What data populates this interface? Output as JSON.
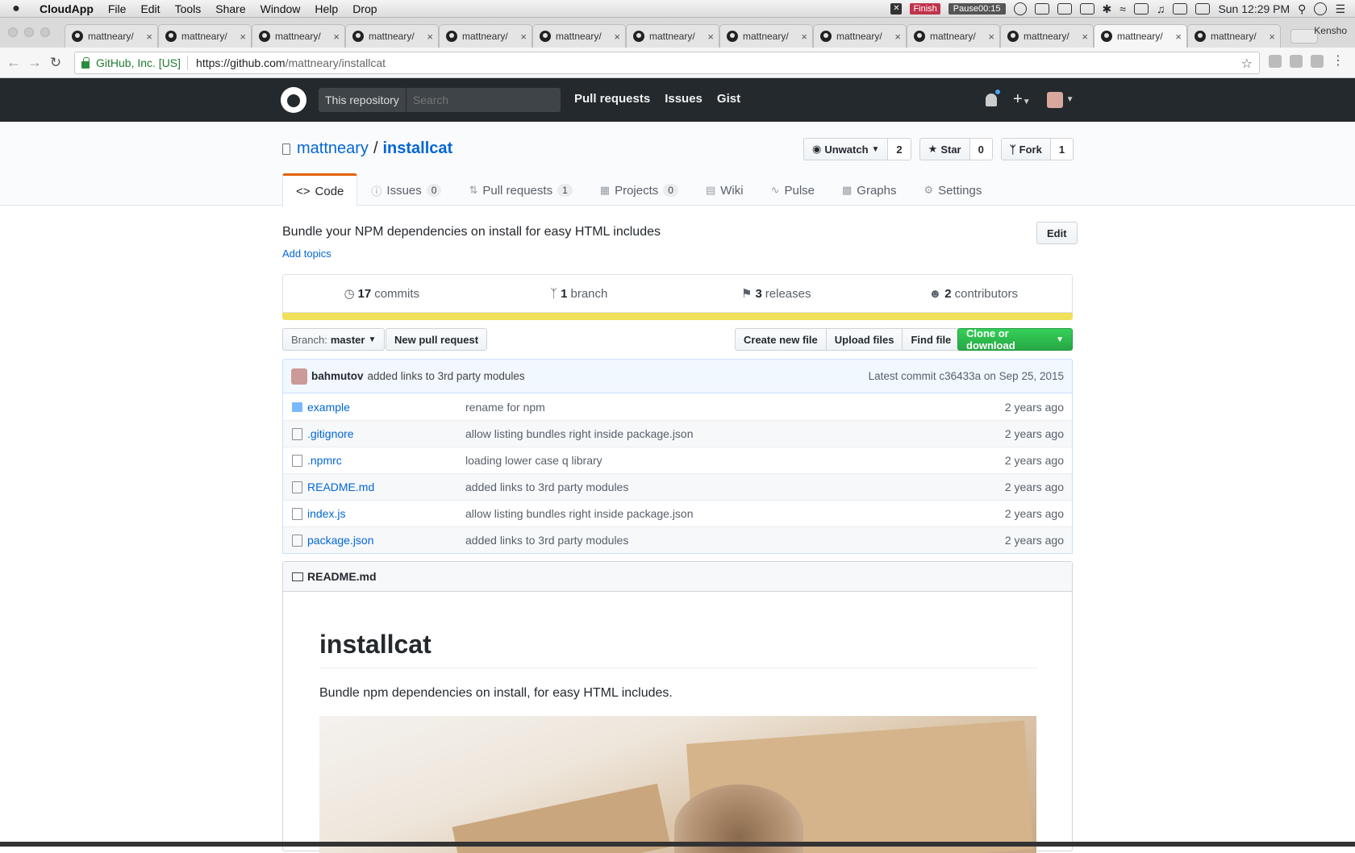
{
  "menubar": {
    "app": "CloudApp",
    "items": [
      "File",
      "Edit",
      "Tools",
      "Share",
      "Window",
      "Help",
      "Drop"
    ],
    "recording": {
      "finish": "Finish",
      "pause": "Pause",
      "timer": "00:15"
    },
    "clock": "Sun 12:29 PM"
  },
  "browser": {
    "tab_title": "mattneary/",
    "tab_count": 13,
    "active_tab_index": 11,
    "profile": "Kensho",
    "secure_label": "GitHub, Inc. [US]",
    "url_host": "https://github.com",
    "url_path": "/mattneary/installcat"
  },
  "gh_header": {
    "scope": "This repository",
    "search_placeholder": "Search",
    "nav": [
      "Pull requests",
      "Issues",
      "Gist"
    ]
  },
  "repo": {
    "owner": "mattneary",
    "name": "installcat",
    "watch": {
      "label": "Unwatch",
      "count": "2"
    },
    "star": {
      "label": "Star",
      "count": "0"
    },
    "fork": {
      "label": "Fork",
      "count": "1"
    },
    "tabs": [
      {
        "label": "Code"
      },
      {
        "label": "Issues",
        "count": "0"
      },
      {
        "label": "Pull requests",
        "count": "1"
      },
      {
        "label": "Projects",
        "count": "0"
      },
      {
        "label": "Wiki"
      },
      {
        "label": "Pulse"
      },
      {
        "label": "Graphs"
      },
      {
        "label": "Settings"
      }
    ],
    "description": "Bundle your NPM dependencies on install for easy HTML includes",
    "add_topics": "Add topics",
    "edit": "Edit",
    "summary": {
      "commits": {
        "num": "17",
        "label": "commits"
      },
      "branches": {
        "num": "1",
        "label": "branch"
      },
      "releases": {
        "num": "3",
        "label": "releases"
      },
      "contributors": {
        "num": "2",
        "label": "contributors"
      }
    },
    "lang_color": "#f1e05a",
    "branch_label": "Branch:",
    "branch": "master",
    "new_pr": "New pull request",
    "file_actions": [
      "Create new file",
      "Upload files",
      "Find file"
    ],
    "clone": "Clone or download",
    "latest_commit": {
      "author": "bahmutov",
      "message": "added links to 3rd party modules",
      "meta": "Latest commit c36433a on Sep 25, 2015"
    },
    "files": [
      {
        "name": "example",
        "type": "dir",
        "message": "rename for npm",
        "age": "2 years ago"
      },
      {
        "name": ".gitignore",
        "type": "file",
        "message": "allow listing bundles right inside package.json",
        "age": "2 years ago"
      },
      {
        "name": ".npmrc",
        "type": "file",
        "message": "loading lower case q library",
        "age": "2 years ago"
      },
      {
        "name": "README.md",
        "type": "file",
        "message": "added links to 3rd party modules",
        "age": "2 years ago"
      },
      {
        "name": "index.js",
        "type": "file",
        "message": "allow listing bundles right inside package.json",
        "age": "2 years ago"
      },
      {
        "name": "package.json",
        "type": "file",
        "message": "added links to 3rd party modules",
        "age": "2 years ago"
      }
    ],
    "readme": {
      "filename": "README.md",
      "title": "installcat",
      "text": "Bundle npm dependencies on install, for easy HTML includes."
    }
  }
}
